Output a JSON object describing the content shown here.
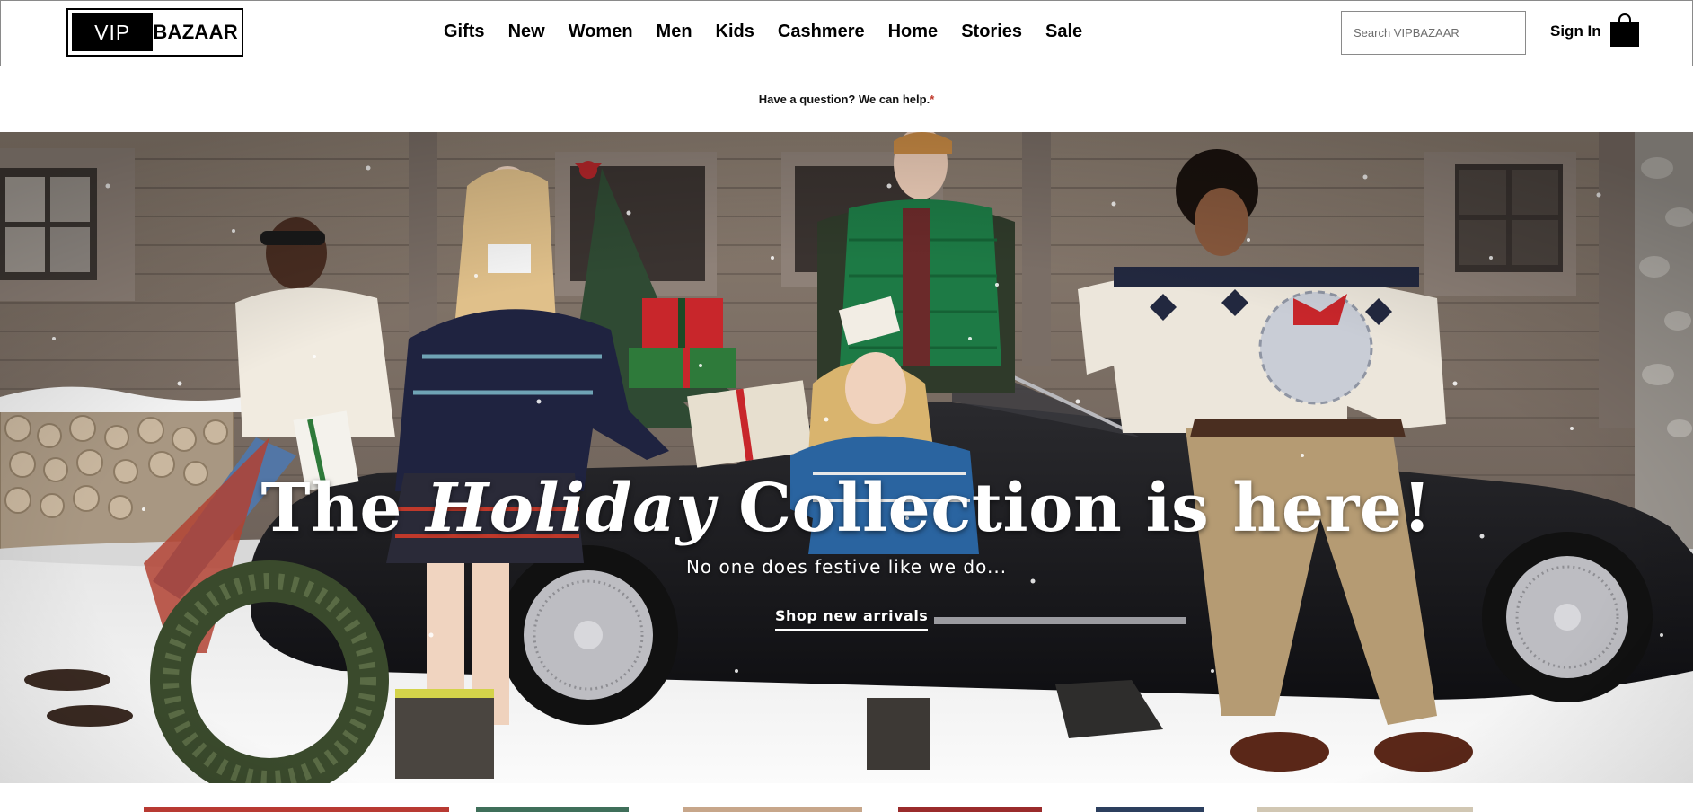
{
  "brand": {
    "logo_left": "VIP",
    "logo_right": "BAZAAR"
  },
  "nav": {
    "items": [
      {
        "label": "Gifts"
      },
      {
        "label": "New"
      },
      {
        "label": "Women"
      },
      {
        "label": "Men"
      },
      {
        "label": "Kids"
      },
      {
        "label": "Cashmere"
      },
      {
        "label": "Home"
      },
      {
        "label": "Stories"
      },
      {
        "label": "Sale"
      }
    ]
  },
  "search": {
    "placeholder": "Search VIPBAZAAR",
    "value": ""
  },
  "account": {
    "signin_label": "Sign In",
    "bag_icon": "shopping-bag-icon"
  },
  "help_bar": {
    "text": "Have a question? We can help.",
    "marker": "*"
  },
  "hero": {
    "title_before": "The ",
    "title_italic": "Holiday",
    "title_after": " Collection is here!",
    "subtitle": "No one does festive like we do...",
    "cta_label": "Shop new arrivals"
  },
  "colors": {
    "text": "#000000",
    "header_border": "#8a8a8a",
    "hero_text": "#ffffff",
    "help_marker": "#c0392b"
  }
}
